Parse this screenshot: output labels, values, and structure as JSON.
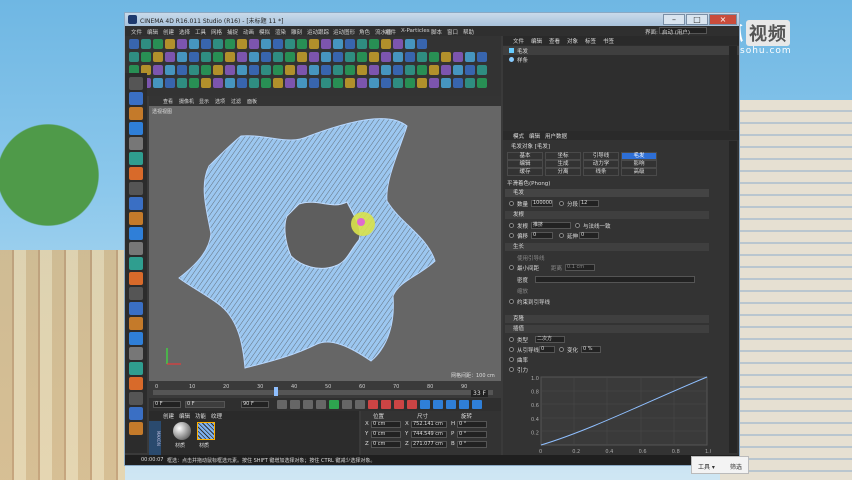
{
  "watermark": {
    "title": "搜狐",
    "badge": "视频",
    "url": "tv.sohu.com"
  },
  "window": {
    "title": "CINEMA 4D R16.011 Studio (R16) - [未标题 11 *]"
  },
  "menu": [
    "文件",
    "编辑",
    "创建",
    "选择",
    "工具",
    "网格",
    "捕捉",
    "动画",
    "模拟",
    "渲染",
    "雕刻",
    "运动跟踪",
    "运动图形",
    "角色",
    "流水线",
    "插件",
    "X-Particles",
    "脚本",
    "窗口",
    "帮助"
  ],
  "layout_label": "界面:",
  "layout_value": "启动 (用户)",
  "viewport": {
    "menu": [
      "查看",
      "摄像机",
      "显示",
      "选项",
      "过滤",
      "面板"
    ],
    "label": "透视视图",
    "grid_spacing": "网格间距：100 cm"
  },
  "timeline": {
    "ticks": [
      "0",
      "10",
      "20",
      "30",
      "40",
      "50",
      "60",
      "70",
      "80",
      "90"
    ],
    "current": "33 F"
  },
  "transport": {
    "start": "0 F",
    "current_field": "0 F",
    "end": "90 F",
    "end2": "90 F"
  },
  "materials": {
    "tabs": [
      "创建",
      "编辑",
      "功能",
      "纹理"
    ],
    "items": [
      {
        "name": "材质"
      },
      {
        "name": "材质"
      }
    ]
  },
  "coords": {
    "headers": [
      "位置",
      "尺寸",
      "旋转"
    ],
    "rows": [
      {
        "axis": "X",
        "pos": "0 cm",
        "size_axis": "X",
        "size": "752.141 cm",
        "rot_axis": "H",
        "rot": "0 °"
      },
      {
        "axis": "Y",
        "pos": "0 cm",
        "size_axis": "Y",
        "size": "744.549 cm",
        "rot_axis": "P",
        "rot": "0 °"
      },
      {
        "axis": "Z",
        "pos": "0 cm",
        "size_axis": "Z",
        "size": "271.077 cm",
        "rot_axis": "B",
        "rot": "0 °"
      }
    ],
    "mode1": "对象 (相对)",
    "mode2": "绝对尺寸",
    "apply": "应用"
  },
  "status": {
    "time": "00:00:07",
    "text": "框选：点击并拖动鼠标框选元素。按住 SHIFT 键增加选择对象；按住 CTRL 键减少选择对象。"
  },
  "object_manager": {
    "tabs": [
      "文件",
      "编辑",
      "查看",
      "对象",
      "标签",
      "书签"
    ],
    "objects": [
      "毛发",
      "样条"
    ]
  },
  "attr": {
    "tabs": [
      "模式",
      "编辑",
      "用户数据"
    ],
    "title": "毛发对象 [毛发]",
    "tab_grid": [
      [
        "基本",
        "坐标",
        "引导线",
        "毛发"
      ],
      [
        "编辑",
        "生成",
        "动力学",
        "影响"
      ],
      [
        "缓存",
        "分离",
        "线条",
        "高级"
      ]
    ],
    "smooth": "平滑着色(Phong)",
    "section_hair": "毛发",
    "count_label": "数量",
    "count": "100000",
    "seg_label": "分段",
    "seg": "12",
    "section_root": "发根",
    "root_label": "发根",
    "root_value": "推挤",
    "align_label": "与法线一致",
    "offset_label": "偏移",
    "offset": "0",
    "extend_label": "延伸",
    "extend": "0",
    "section_grow": "生长",
    "use_guides": "使用引导线",
    "min_spacing_label": "最小间距",
    "distance_label": "距离",
    "distance": "0.1 cm",
    "density_label": "密度",
    "scale_label": "缩放",
    "constrain_label": "约束到引导线",
    "section_dup": "克隆",
    "section_interp": "插值",
    "type_label": "类型",
    "type_value": "二次方",
    "from_guide_label": "从引导线",
    "from_guide": "0",
    "variation_label": "变化",
    "variation": "0 %",
    "curve_label": "曲率",
    "pull_label": "引力",
    "graph_x": [
      "0",
      "0.2",
      "0.4",
      "0.6",
      "0.8",
      "1.0"
    ],
    "graph_y": [
      "1.0",
      "0.8",
      "0.6",
      "0.4",
      "0.2"
    ]
  },
  "popup": {
    "b1": "工具 ▾",
    "b2": "筛选"
  }
}
